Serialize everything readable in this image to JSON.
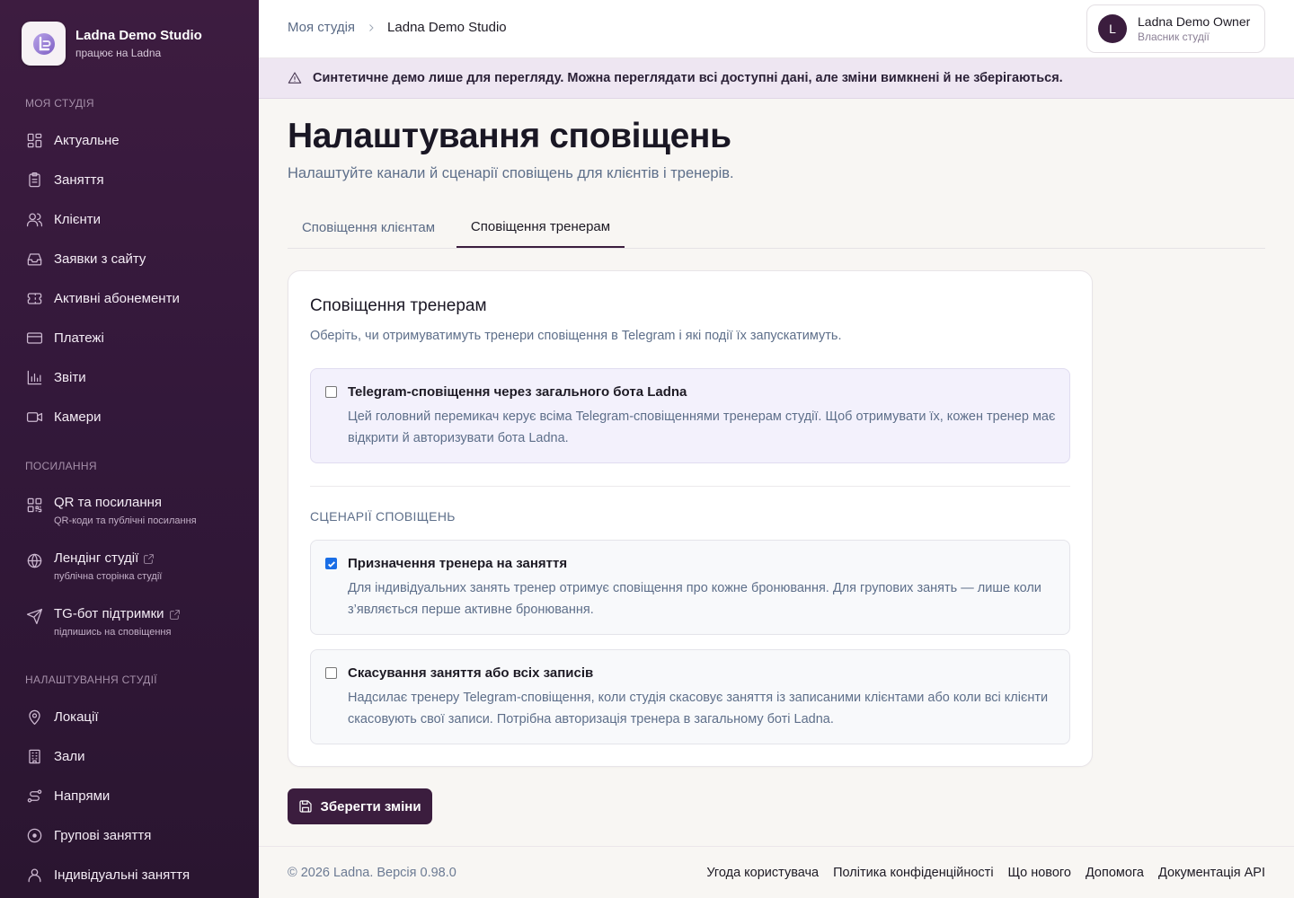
{
  "brand": {
    "name": "Ladna Demo Studio",
    "subtitle": "працює на Ladna"
  },
  "sidebar": {
    "section1": "Моя студія",
    "section2": "Посилання",
    "section3": "Налаштування студії",
    "items": [
      {
        "label": "Актуальне",
        "icon": "dashboard-icon"
      },
      {
        "label": "Заняття",
        "icon": "clipboard-icon"
      },
      {
        "label": "Клієнти",
        "icon": "users-icon"
      },
      {
        "label": "Заявки з сайту",
        "icon": "inbox-icon"
      },
      {
        "label": "Активні абонементи",
        "icon": "ticket-icon"
      },
      {
        "label": "Платежі",
        "icon": "credit-card-icon"
      },
      {
        "label": "Звіти",
        "icon": "bar-chart-icon"
      },
      {
        "label": "Камери",
        "icon": "video-icon"
      }
    ],
    "links": [
      {
        "label": "QR та посилання",
        "sub": "QR-коди та публічні посилання",
        "icon": "qr-code-icon"
      },
      {
        "label": "Лендінг студії",
        "sub": "публічна сторінка студії",
        "icon": "globe-icon"
      },
      {
        "label": "TG-бот підтримки",
        "sub": "підпишись на сповіщення",
        "icon": "send-icon"
      }
    ],
    "settings": [
      {
        "label": "Локації",
        "icon": "map-pin-icon"
      },
      {
        "label": "Зали",
        "icon": "building-icon"
      },
      {
        "label": "Напрями",
        "icon": "route-icon"
      },
      {
        "label": "Групові заняття",
        "icon": "circle-icon"
      },
      {
        "label": "Індивідуальні заняття",
        "icon": "user-icon"
      }
    ]
  },
  "header": {
    "breadcrumb_root": "Моя студія",
    "breadcrumb_current": "Ladna Demo Studio",
    "user_initial": "L",
    "user_name": "Ladna Demo Owner",
    "user_role": "Власник студії"
  },
  "banner": {
    "text": "Синтетичне демо лише для перегляду. Можна переглядати всі доступні дані, але зміни вимкнені й не зберігаються."
  },
  "page": {
    "title": "Налаштування сповіщень",
    "subtitle": "Налаштуйте канали й сценарії сповіщень для клієнтів і тренерів."
  },
  "tabs": [
    {
      "label": "Сповіщення клієнтам",
      "active": false
    },
    {
      "label": "Сповіщення тренерам",
      "active": true
    }
  ],
  "card": {
    "title": "Сповіщення тренерам",
    "subtitle": "Оберіть, чи отримуватимуть тренери сповіщення в Telegram і які події їх запускатимуть.",
    "master": {
      "title": "Telegram-сповіщення через загального бота Ladna",
      "desc": "Цей головний перемикач керує всіма Telegram-сповіщеннями тренерам студії. Щоб отримувати їх, кожен тренер має відкрити й авторизувати бота Ladna.",
      "checked": false
    },
    "section_label": "Сценарії сповіщень",
    "scenarios": [
      {
        "title": "Призначення тренера на заняття",
        "desc": "Для індивідуальних занять тренер отримує сповіщення про кожне бронювання. Для групових занять — лише коли з’являється перше активне бронювання.",
        "checked": true
      },
      {
        "title": "Скасування заняття або всіх записів",
        "desc": "Надсилає тренеру Telegram-сповіщення, коли студія скасовує заняття із записаними клієнтами або коли всі клієнти скасовують свої записи. Потрібна авторизація тренера в загальному боті Ladna.",
        "checked": false
      }
    ]
  },
  "save_button": "Зберегти зміни",
  "footer": {
    "copyright": "© 2026 Ladna. Версія 0.98.0",
    "links": [
      "Угода користувача",
      "Політика конфіденційності",
      "Що нового",
      "Допомога",
      "Документація API"
    ]
  }
}
